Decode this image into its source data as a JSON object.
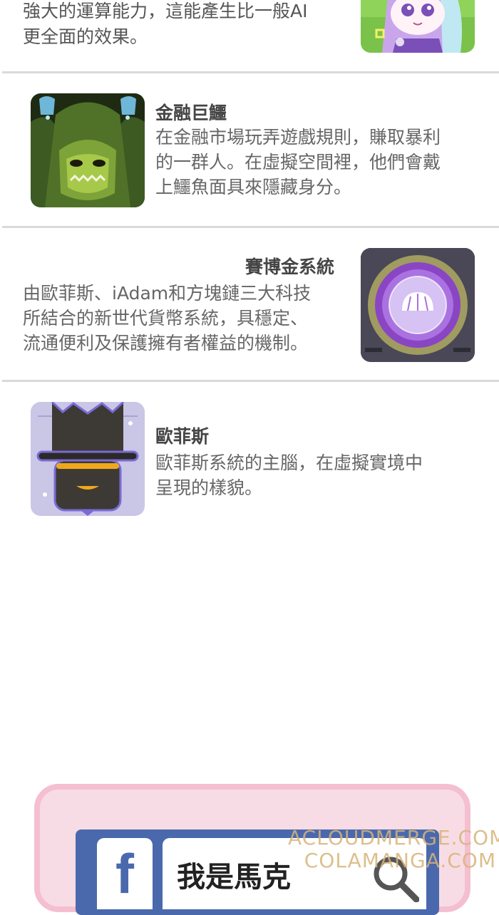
{
  "top_entry": {
    "lines": [
      "強大的運算能力，這能產生比一般AI",
      "更全面的效果。"
    ]
  },
  "entries": [
    {
      "title": "金融巨鱷",
      "lines": [
        "在金融市場玩弄遊戲規則，賺取暴利",
        "的一群人。在虛擬空間裡，他們會戴",
        "上鱷魚面具來隱藏身分。"
      ],
      "icon": "crocodile-mask-icon"
    },
    {
      "title": "賽博金系統",
      "lines": [
        "由歐菲斯、iAdam和方塊鏈三大科技",
        "所結合的新世代貨幣系統，具穩定、",
        "流通便利及保護擁有者權益的機制。"
      ],
      "icon": "cyber-coin-icon"
    },
    {
      "title": "歐菲斯",
      "lines": [
        "歐菲斯系統的主腦，在虛擬實境中",
        "呈現的樣貌。"
      ],
      "icon": "robot-head-icon"
    }
  ],
  "facebook_card": {
    "logo_letter": "f",
    "name": "我是馬克"
  },
  "watermark": {
    "line1": "ACLOUDMERGE.COM",
    "line2": "COLAMANGA.COM"
  },
  "colors": {
    "divider": "#d9d9d9",
    "card_bg": "#f8dce5",
    "card_border": "#f4bfd0",
    "facebook_blue": "#4a69ad"
  }
}
